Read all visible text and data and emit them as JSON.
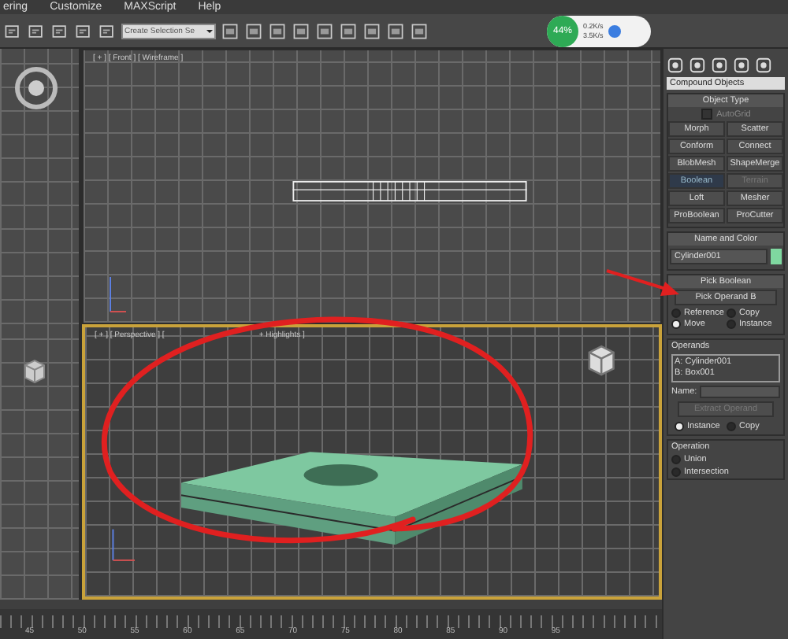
{
  "menu": [
    "ering",
    "Customize",
    "MAXScript",
    "Help"
  ],
  "toolbar": {
    "selection_set": "Create Selection Se"
  },
  "network": {
    "percent": "44%",
    "upload": "0.2K/s",
    "download": "3.5K/s"
  },
  "viewports": [
    {
      "labels": [
        "[ + ] [ Front ] [ Wireframe ]"
      ],
      "active": false
    },
    {
      "labels": [
        "[ + ] [ Perspective ] [",
        "+ Highlights ]"
      ],
      "active": true
    }
  ],
  "command_panel": {
    "category": "Compound Objects",
    "object_type": {
      "title": "Object Type",
      "autogrid": {
        "label": "AutoGrid",
        "checked": false
      },
      "buttons": [
        {
          "label": "Morph",
          "selected": false,
          "disabled": false
        },
        {
          "label": "Scatter",
          "selected": false,
          "disabled": false
        },
        {
          "label": "Conform",
          "selected": false,
          "disabled": false
        },
        {
          "label": "Connect",
          "selected": false,
          "disabled": false
        },
        {
          "label": "BlobMesh",
          "selected": false,
          "disabled": false
        },
        {
          "label": "ShapeMerge",
          "selected": false,
          "disabled": false
        },
        {
          "label": "Boolean",
          "selected": true,
          "disabled": false
        },
        {
          "label": "Terrain",
          "selected": false,
          "disabled": true
        },
        {
          "label": "Loft",
          "selected": false,
          "disabled": false
        },
        {
          "label": "Mesher",
          "selected": false,
          "disabled": false
        },
        {
          "label": "ProBoolean",
          "selected": false,
          "disabled": false
        },
        {
          "label": "ProCutter",
          "selected": false,
          "disabled": false
        }
      ]
    },
    "name_and_color": {
      "title": "Name and Color",
      "name": "Cylinder001",
      "color": "#7fd8a0"
    },
    "pick_boolean": {
      "title": "Pick Boolean",
      "button": "Pick Operand B",
      "options": [
        {
          "label": "Reference",
          "selected": false
        },
        {
          "label": "Copy",
          "selected": false
        },
        {
          "label": "Move",
          "selected": true
        },
        {
          "label": "Instance",
          "selected": false
        }
      ]
    },
    "operands": {
      "title": "Operands",
      "items": [
        "A: Cylinder001",
        "B: Box001"
      ],
      "name_label": "Name:",
      "extract": {
        "label": "Extract Operand",
        "disabled": true
      },
      "options": [
        {
          "label": "Instance",
          "selected": true
        },
        {
          "label": "Copy",
          "selected": false
        }
      ]
    },
    "operation": {
      "title": "Operation",
      "options": [
        {
          "label": "Union",
          "selected": false
        },
        {
          "label": "Intersection",
          "selected": false
        }
      ]
    }
  },
  "timeline": {
    "ticks": [
      "45",
      "50",
      "55",
      "60",
      "65",
      "70",
      "75",
      "80",
      "85",
      "90",
      "95"
    ]
  }
}
